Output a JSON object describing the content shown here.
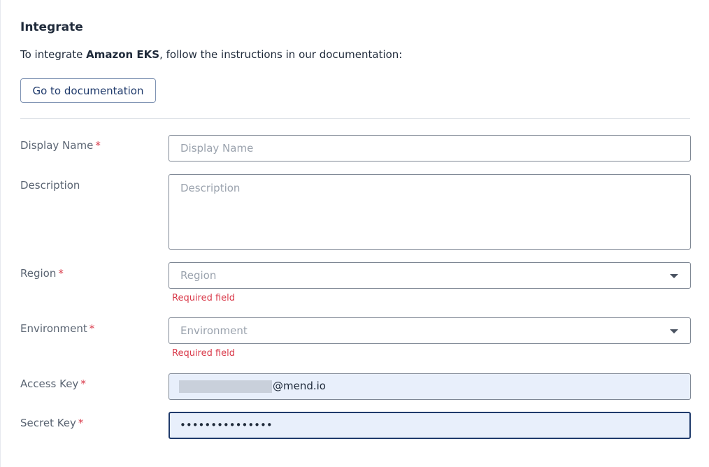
{
  "section": {
    "title": "Integrate",
    "intro_prefix": "To integrate ",
    "intro_product": "Amazon EKS",
    "intro_suffix": ", follow the instructions in our documentation:",
    "doc_button_label": "Go to documentation"
  },
  "form": {
    "required_mark": "*",
    "display_name": {
      "label": "Display Name",
      "placeholder": "Display Name",
      "required": true
    },
    "description": {
      "label": "Description",
      "placeholder": "Description",
      "required": false
    },
    "region": {
      "label": "Region",
      "placeholder": "Region",
      "required": true,
      "error": "Required field"
    },
    "environment": {
      "label": "Environment",
      "placeholder": "Environment",
      "required": true,
      "error": "Required field"
    },
    "access_key": {
      "label": "Access Key",
      "value_suffix": "@mend.io",
      "required": true
    },
    "secret_key": {
      "label": "Secret Key",
      "value_masked": "•••••••••••••••",
      "required": true
    }
  },
  "colors": {
    "accent": "#1f3a6b",
    "error": "#d93a4a",
    "filled_bg": "#e8effb"
  }
}
